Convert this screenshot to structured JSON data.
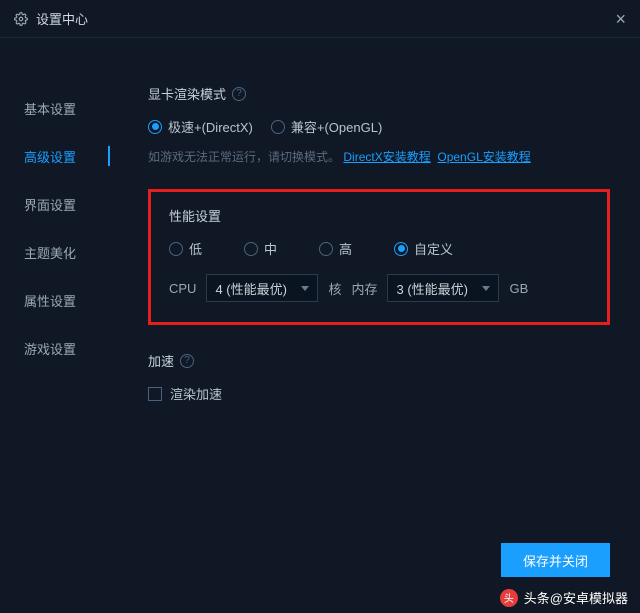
{
  "titlebar": {
    "title": "设置中心"
  },
  "sidebar": {
    "items": [
      {
        "label": "基本设置"
      },
      {
        "label": "高级设置"
      },
      {
        "label": "界面设置"
      },
      {
        "label": "主题美化"
      },
      {
        "label": "属性设置"
      },
      {
        "label": "游戏设置"
      }
    ],
    "activeIndex": 1
  },
  "render": {
    "title": "显卡渲染模式",
    "options": [
      {
        "label": "极速+(DirectX)",
        "checked": true
      },
      {
        "label": "兼容+(OpenGL)",
        "checked": false
      }
    ],
    "hint_prefix": "如游戏无法正常运行，请切换模式。",
    "link1": "DirectX安装教程",
    "link2": "OpenGL安装教程"
  },
  "perf": {
    "title": "性能设置",
    "options": [
      {
        "label": "低",
        "checked": false
      },
      {
        "label": "中",
        "checked": false
      },
      {
        "label": "高",
        "checked": false
      },
      {
        "label": "自定义",
        "checked": true
      }
    ],
    "cpu_label": "CPU",
    "cpu_value": "4 (性能最优)",
    "cpu_unit": "核",
    "mem_label": "内存",
    "mem_value": "3 (性能最优)",
    "mem_unit": "GB"
  },
  "accel": {
    "title": "加速",
    "checkbox_label": "渲染加速"
  },
  "footer": {
    "save_label": "保存并关闭"
  },
  "watermark": {
    "text": "头条@安卓模拟器"
  }
}
